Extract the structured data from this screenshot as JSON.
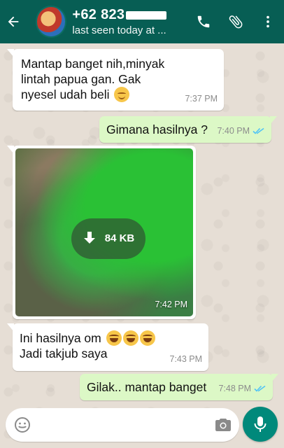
{
  "header": {
    "contact_name": "+62 823",
    "status": "last seen today at ..."
  },
  "messages": [
    {
      "direction": "in",
      "text_lines": [
        "Mantap banget nih,minyak",
        "lintah papua gan. Gak",
        "nyesel udah beli"
      ],
      "time": "7:37 PM"
    },
    {
      "direction": "out",
      "text": "Gimana hasilnya ?",
      "time": "7:40 PM"
    },
    {
      "direction": "in",
      "type": "photo",
      "download_size": "84 KB",
      "time": "7:42 PM"
    },
    {
      "direction": "in",
      "text_lines": [
        "Ini hasilnya om",
        "Jadi takjub saya"
      ],
      "time": "7:43 PM"
    },
    {
      "direction": "out",
      "text": "Gilak.. mantap banget",
      "time": "7:48 PM"
    }
  ],
  "input": {
    "placeholder": ""
  },
  "icons": {
    "back": "back-arrow-icon",
    "call": "phone-icon",
    "attach": "paperclip-icon",
    "menu": "more-vert-icon",
    "emoji": "emoji-icon",
    "camera": "camera-icon",
    "mic": "mic-icon",
    "download": "download-icon"
  },
  "colors": {
    "header": "#075e54",
    "outgoing_bubble": "#dcf8c6",
    "incoming_bubble": "#ffffff",
    "read_ticks": "#4fc3f7",
    "mic_button": "#00897b"
  }
}
